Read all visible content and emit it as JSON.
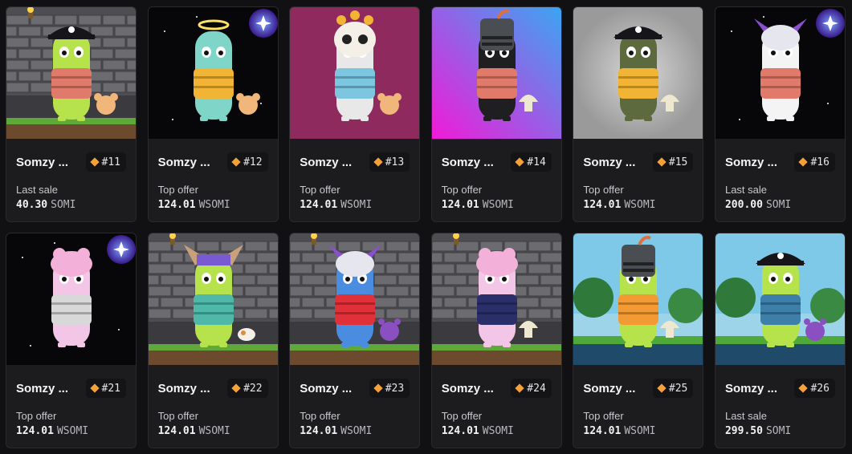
{
  "cards": [
    {
      "name": "Somzy ...",
      "number": "#11",
      "label": "Last sale",
      "amount": "40.30",
      "currency": "SOMI",
      "bg": "castle",
      "hat": "pirate",
      "body": "#b6e34b",
      "armor": "#e07a6a",
      "halo": false,
      "orb": false,
      "pet": "dog"
    },
    {
      "name": "Somzy ...",
      "number": "#12",
      "label": "Top offer",
      "amount": "124.01",
      "currency": "WSOMI",
      "bg": "space",
      "hat": "none",
      "body": "#7fd6c8",
      "armor": "#f2b434",
      "halo": true,
      "orb": true,
      "pet": "dog"
    },
    {
      "name": "Somzy ...",
      "number": "#13",
      "label": "Top offer",
      "amount": "124.01",
      "currency": "WSOMI",
      "bg": "magenta",
      "hat": "skull",
      "body": "#e8e8e8",
      "armor": "#7cc6e0",
      "halo": false,
      "orb": false,
      "pet": "dog"
    },
    {
      "name": "Somzy ...",
      "number": "#14",
      "label": "Top offer",
      "amount": "124.01",
      "currency": "WSOMI",
      "bg": "gradient",
      "hat": "knight",
      "body": "#1f1f22",
      "armor": "#e07a6a",
      "halo": false,
      "orb": false,
      "pet": "mushroom"
    },
    {
      "name": "Somzy ...",
      "number": "#15",
      "label": "Top offer",
      "amount": "124.01",
      "currency": "WSOMI",
      "bg": "gray",
      "hat": "pirate",
      "body": "#5c6a3e",
      "armor": "#f2b434",
      "halo": false,
      "orb": false,
      "pet": "mushroom"
    },
    {
      "name": "Somzy ...",
      "number": "#16",
      "label": "Last sale",
      "amount": "200.00",
      "currency": "SOMI",
      "bg": "space",
      "hat": "bunny",
      "body": "#f4f4f4",
      "armor": "#e07a6a",
      "halo": false,
      "orb": true,
      "pet": "none"
    },
    {
      "name": "Somzy ...",
      "number": "#21",
      "label": "Top offer",
      "amount": "124.01",
      "currency": "WSOMI",
      "bg": "space",
      "hat": "frog",
      "body": "#f3c6e8",
      "armor": "#d8d8d8",
      "halo": false,
      "orb": true,
      "pet": "none"
    },
    {
      "name": "Somzy ...",
      "number": "#22",
      "label": "Top offer",
      "amount": "124.01",
      "currency": "WSOMI",
      "bg": "castle",
      "hat": "cat",
      "body": "#b6e34b",
      "armor": "#4fb8a8",
      "halo": false,
      "orb": false,
      "pet": "cat"
    },
    {
      "name": "Somzy ...",
      "number": "#23",
      "label": "Top offer",
      "amount": "124.01",
      "currency": "WSOMI",
      "bg": "castle",
      "hat": "bunny",
      "body": "#4a8de0",
      "armor": "#e0303a",
      "halo": false,
      "orb": false,
      "pet": "bear"
    },
    {
      "name": "Somzy ...",
      "number": "#24",
      "label": "Top offer",
      "amount": "124.01",
      "currency": "WSOMI",
      "bg": "castle",
      "hat": "frog",
      "body": "#f3c6e8",
      "armor": "#2a2f6a",
      "halo": false,
      "orb": false,
      "pet": "mushroom"
    },
    {
      "name": "Somzy ...",
      "number": "#25",
      "label": "Top offer",
      "amount": "124.01",
      "currency": "WSOMI",
      "bg": "forest",
      "hat": "knight",
      "body": "#b6e34b",
      "armor": "#f29b34",
      "halo": false,
      "orb": false,
      "pet": "mushroom"
    },
    {
      "name": "Somzy ...",
      "number": "#26",
      "label": "Last sale",
      "amount": "299.50",
      "currency": "SOMI",
      "bg": "forest",
      "hat": "pirate",
      "body": "#b6e34b",
      "armor": "#3d7fa8",
      "halo": false,
      "orb": false,
      "pet": "bear"
    }
  ]
}
